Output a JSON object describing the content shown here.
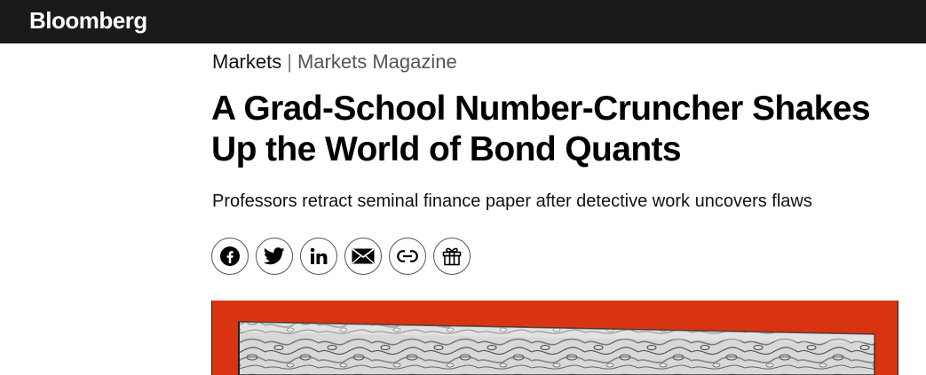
{
  "header": {
    "brand": "Bloomberg"
  },
  "breadcrumb": {
    "primary": "Markets",
    "separator": "|",
    "secondary": "Markets Magazine"
  },
  "article": {
    "headline": "A Grad-School Number-Cruncher Shakes Up the World of Bond Quants",
    "deck": "Professors retract seminal finance paper after detective work uncovers flaws"
  },
  "share": {
    "buttons": [
      {
        "name": "facebook",
        "icon": "facebook-icon"
      },
      {
        "name": "twitter",
        "icon": "twitter-icon"
      },
      {
        "name": "linkedin",
        "icon": "linkedin-icon"
      },
      {
        "name": "email",
        "icon": "email-icon"
      },
      {
        "name": "copy-link",
        "icon": "link-icon"
      },
      {
        "name": "gift",
        "icon": "gift-icon"
      }
    ]
  },
  "hero": {
    "background_color": "#d93412",
    "pattern": "marbled-gray-bar"
  },
  "colors": {
    "topbar": "#1a1a1a",
    "text": "#000000",
    "muted": "#555555"
  }
}
